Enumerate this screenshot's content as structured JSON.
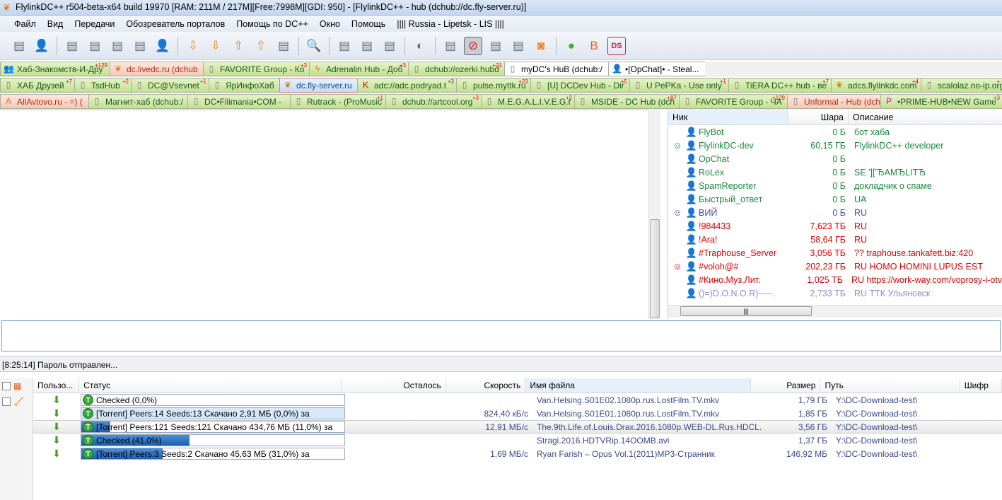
{
  "window": {
    "title": "FlylinkDC++ r504-beta-x64 build 19970 [RAM: 211M / 217M][Free:7998M][GDI: 950] - [FlylinkDC++ - hub (dchub://dc.fly-server.ru)]"
  },
  "menu": [
    "Файл",
    "Вид",
    "Передачи",
    "Обозреватель порталов",
    "Помощь по DC++",
    "Окно",
    "Помощь",
    "|||| Russia - Lipetsk - LIS ||||"
  ],
  "toolbar": {
    "icons": [
      "reconnect-icon",
      "follow-redirect-icon",
      "public-hubs-icon",
      "disconnect-icon",
      "favorite-hubs-icon",
      "favorite-hubs-star-icon",
      "favorite-users-icon",
      "download-queue-icon",
      "finished-downloads-icon",
      "upload-queue-icon",
      "finished-uploads-icon",
      "media-files-icon",
      "search-icon",
      "adl-search-icon",
      "search-spy-icon",
      "network-stats-icon",
      "away-icon",
      "limiter-icon",
      "disable-sounds-icon",
      "notepad-icon",
      "system-log-icon",
      "rss-icon",
      "web-icon",
      "blog-icon",
      "ds-icon"
    ],
    "selected": "disable-sounds-icon"
  },
  "tabs": [
    [
      {
        "label": "Хаб-Знакомств-И-Дру",
        "count": "+129",
        "style": "green",
        "icon": "people-icon"
      },
      {
        "label": "dc.livedc.ru (dchub",
        "count": "",
        "style": "pink",
        "icon": "flylink-icon"
      },
      {
        "label": "FAVORITE Group - Ко",
        "count": "+3",
        "style": "green",
        "icon": "server-icon"
      },
      {
        "label": "Adrenalin Hub - Доб",
        "count": "+3",
        "style": "green",
        "icon": "lightning-icon"
      },
      {
        "label": "dchub://ozerki.hubd",
        "count": "+21",
        "style": "green",
        "icon": "server-icon"
      },
      {
        "label": "myDC's HuB (dchub:/",
        "count": "",
        "style": "white",
        "icon": "server-icon"
      },
      {
        "label": "•[OpChat]• - Steal...",
        "count": "",
        "style": "white",
        "icon": "user-icon"
      }
    ],
    [
      {
        "label": "ХАБ Друзей",
        "count": "+7",
        "style": "green",
        "icon": "server-icon"
      },
      {
        "label": "TsdHub",
        "count": "+2",
        "style": "green",
        "icon": "server-icon"
      },
      {
        "label": "DC@Vsevnet",
        "count": "+1",
        "style": "green",
        "icon": "server-icon"
      },
      {
        "label": "ЯрИнфоХаб",
        "count": "",
        "style": "green",
        "icon": "server-icon"
      },
      {
        "label": "dc.fly-server.ru",
        "count": "",
        "style": "active",
        "icon": "flylink-icon"
      },
      {
        "label": "adc://adc.podryad.t",
        "count": "+3",
        "style": "green",
        "icon": "k-logo-icon"
      },
      {
        "label": "pulse.myttk.ru",
        "count": "+23",
        "style": "green",
        "icon": "server-icon"
      },
      {
        "label": "[U] DCDev Hub - Dir",
        "count": "+5",
        "style": "green",
        "icon": "server-icon"
      },
      {
        "label": "U PePKa - Use only",
        "count": "+1",
        "style": "green",
        "icon": "server-icon"
      },
      {
        "label": "TiERA DC++ hub - ве",
        "count": "+7",
        "style": "green",
        "icon": "server-icon"
      },
      {
        "label": "adcs.flylinkdc.com",
        "count": "+4",
        "style": "green",
        "icon": "flylink-icon"
      },
      {
        "label": "scalolaz.no-ip.org",
        "count": "+",
        "style": "green",
        "icon": "server-icon"
      }
    ],
    [
      {
        "label": "AllAvtovo.ru - =) (",
        "count": "",
        "style": "pink",
        "icon": "a-logo-icon"
      },
      {
        "label": "Магнит-хаб (dchub:/",
        "count": "",
        "style": "green",
        "icon": "server-icon"
      },
      {
        "label": "DC•Filimania•COM -",
        "count": "",
        "style": "green",
        "icon": "server-icon"
      },
      {
        "label": "Rutrack - (ProMusic",
        "count": "+1",
        "style": "green",
        "icon": "server-icon"
      },
      {
        "label": "dchub://artcool.org",
        "count": "+3",
        "style": "green",
        "icon": "server-icon"
      },
      {
        "label": "M.E.G.A.L.I.V.E.G.r",
        "count": "+2",
        "style": "green",
        "icon": "server-icon"
      },
      {
        "label": "MSIDE - DC Hub (dch",
        "count": "+97",
        "style": "green",
        "icon": "server-icon"
      },
      {
        "label": "FAVORITE Group - ЧА",
        "count": "+129",
        "style": "green",
        "icon": "server-icon"
      },
      {
        "label": "Unformal - Hub (dch",
        "count": "",
        "style": "pink",
        "icon": "server-icon"
      },
      {
        "label": "•PRIME-HUB•NEW Game",
        "count": "+3",
        "style": "green",
        "icon": "prime-logo-icon"
      }
    ]
  ],
  "users": {
    "columns": [
      "Ник",
      "Шара",
      "Описание"
    ],
    "rows": [
      {
        "nick": "FlyBot",
        "share": "0 Б",
        "desc": "бот хаба",
        "color": "#1a8a3a",
        "avatar": ""
      },
      {
        "nick": "FlylinkDC-dev",
        "share": "60,15 ГБ",
        "desc": "FlylinkDC++ developer",
        "color": "#1a8a3a",
        "avatar": "face"
      },
      {
        "nick": "OpChat",
        "share": "0 Б",
        "desc": "",
        "color": "#1a8a3a",
        "avatar": ""
      },
      {
        "nick": "RoLex",
        "share": "0 Б",
        "desc": "SE ']['ЂАМЂLITЂ",
        "color": "#1a8a3a",
        "avatar": ""
      },
      {
        "nick": "SpamReporter",
        "share": "0 Б",
        "desc": "докладчик о спаме",
        "color": "#1a8a3a",
        "avatar": ""
      },
      {
        "nick": "Быстрый_ответ",
        "share": "0 Б",
        "desc": "UA",
        "color": "#1a8a3a",
        "avatar": ""
      },
      {
        "nick": "ВИЙ",
        "share": "0 Б",
        "desc": "RU",
        "color": "#4a4aa8",
        "avatar": "face"
      },
      {
        "nick": "!984433",
        "share": "7,623 ТБ",
        "desc": "RU",
        "color": "#e00000",
        "avatar": ""
      },
      {
        "nick": "!Ara!",
        "share": "58,64 ГБ",
        "desc": "RU",
        "color": "#e00000",
        "avatar": ""
      },
      {
        "nick": "#Traphouse_Server",
        "share": "3,056 ТБ",
        "desc": "?? traphouse.tankafett.biz:420",
        "color": "#e00000",
        "avatar": ""
      },
      {
        "nick": "#voloh@#",
        "share": "202,23 ГБ",
        "desc": "RU HOMO HOMINI LUPUS EST",
        "color": "#e00000",
        "avatar": "face"
      },
      {
        "nick": "#Кино.Муз.Лит.",
        "share": "1,025 ТБ",
        "desc": "RU https://work-way.com/voprosy-i-otv",
        "color": "#e00000",
        "avatar": ""
      },
      {
        "nick": "()=)D.O.N.O.R)-----.",
        "share": "2,733 ТБ",
        "desc": "RU  ТТК Ульяновск",
        "color": "#8a8ae0",
        "avatar": ""
      }
    ]
  },
  "chat": {
    "input_value": ""
  },
  "status": "[8:25:14] Пароль отправлен...",
  "transfers": {
    "columns": [
      "Пользо...",
      "Статус",
      "Осталось",
      "Скорость",
      "Имя файла",
      "Размер",
      "Путь",
      "Шифр"
    ],
    "rows": [
      {
        "status": "Checked (0,0%)",
        "progress": 0,
        "remaining": "",
        "speed": "",
        "file": "Van.Helsing.S01E02.1080p.rus.LostFilm.TV.mkv",
        "size": "1,79 ГБ",
        "path": "Y:\\DC-Download-test\\"
      },
      {
        "status": "[Torrent] Peers:14 Seeds:13 Скачано 2,91 МБ (0,0%) за",
        "progress": 0,
        "remaining": "",
        "speed": "824,40 кБ/с",
        "file": "Van.Helsing.S01E01.1080p.rus.LostFilm.TV.mkv",
        "size": "1,85 ГБ",
        "path": "Y:\\DC-Download-test\\"
      },
      {
        "status": "[Torrent] Peers:121 Seeds:121 Скачано 434,76 МБ (11,0%) за",
        "progress": 11,
        "remaining": "",
        "speed": "12,91 МБ/с",
        "file": "The.9th.Life.of.Louis.Drax.2016.1080p.WEB-DL.Rus.HDCL...",
        "size": "3,56 ГБ",
        "path": "Y:\\DC-Download-test\\"
      },
      {
        "status": "Checked (41,0%)",
        "progress": 41,
        "remaining": "",
        "speed": "",
        "file": "Stragi.2016.HDTVRip.14OOMB.avi",
        "size": "1,37 ГБ",
        "path": "Y:\\DC-Download-test\\"
      },
      {
        "status": "[Torrent] Peers:3 Seeds:2 Скачано 45,63 МБ (31,0%) за",
        "progress": 31,
        "remaining": "",
        "speed": "1,69 МБ/с",
        "file": "Ryan Farish – Opus Vol.1(2011)MP3-Странник",
        "size": "146,92 МБ",
        "path": "Y:\\DC-Download-test\\"
      }
    ]
  }
}
